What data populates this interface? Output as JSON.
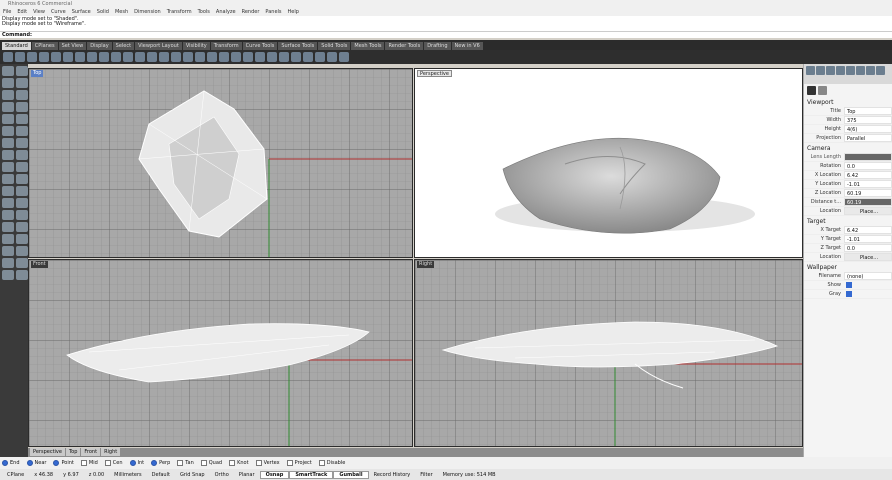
{
  "window": {
    "title": "Rhinoceros 6 Commercial"
  },
  "menu": [
    "File",
    "Edit",
    "View",
    "Curve",
    "Surface",
    "Solid",
    "Mesh",
    "Dimension",
    "Transform",
    "Tools",
    "Analyze",
    "Render",
    "Panels",
    "Help"
  ],
  "command_history": [
    "Display mode set to \"Shaded\".",
    "Display mode set to \"Wireframe\"."
  ],
  "command_prompt": "Command:",
  "toolbar_tabs": [
    "Standard",
    "CPlanes",
    "Set View",
    "Display",
    "Select",
    "Viewport Layout",
    "Visibility",
    "Transform",
    "Curve Tools",
    "Surface Tools",
    "Solid Tools",
    "Mesh Tools",
    "Render Tools",
    "Drafting",
    "New in V6"
  ],
  "active_toolbar_tab": "Standard",
  "viewports": {
    "top": {
      "title": "Top"
    },
    "perspective": {
      "title": "Perspective"
    },
    "front": {
      "title": "Front"
    },
    "right": {
      "title": "Right"
    }
  },
  "viewport_tabs": [
    "Perspective",
    "Top",
    "Front",
    "Right"
  ],
  "panel": {
    "viewport_header": "Viewport",
    "title_label": "Title",
    "title_value": "Top",
    "width_label": "Width",
    "width_value": "375",
    "height_label": "Height",
    "height_value": "4(6)",
    "projection_label": "Projection",
    "projection_value": "Parallel",
    "camera_header": "Camera",
    "lens_label": "Lens Length",
    "rotation_label": "Rotation",
    "rotation_value": "0.0",
    "xloc_label": "X Location",
    "xloc_value": "6.42",
    "yloc_label": "Y Location",
    "yloc_value": "-1.01",
    "zloc_label": "Z Location",
    "zloc_value": "60.19",
    "dist_label": "Distance t...",
    "dist_value": "60.19",
    "location_label": "Location",
    "location_btn": "Place...",
    "target_header": "Target",
    "xt_label": "X Target",
    "xt_value": "6.42",
    "yt_label": "Y Target",
    "yt_value": "-1.01",
    "zt_label": "Z Target",
    "zt_value": "0.0",
    "tloc_label": "Location",
    "tloc_btn": "Place...",
    "wallpaper_header": "Wallpaper",
    "filename_label": "Filename",
    "filename_value": "(none)",
    "show_label": "Show",
    "gray_label": "Gray"
  },
  "osnaps": [
    {
      "label": "End",
      "on": true
    },
    {
      "label": "Near",
      "on": true
    },
    {
      "label": "Point",
      "on": true
    },
    {
      "label": "Mid",
      "on": false
    },
    {
      "label": "Cen",
      "on": false
    },
    {
      "label": "Int",
      "on": true
    },
    {
      "label": "Perp",
      "on": true
    },
    {
      "label": "Tan",
      "on": false
    },
    {
      "label": "Quad",
      "on": false
    },
    {
      "label": "Knot",
      "on": false
    },
    {
      "label": "Vertex",
      "on": false
    },
    {
      "label": "Project",
      "on": false
    },
    {
      "label": "Disable",
      "on": false
    }
  ],
  "status": {
    "cplane": "CPlane",
    "x": "x 46.38",
    "y": "y 6.97",
    "z": "z 0.00",
    "units": "Millimeters",
    "layer": "Default",
    "grid_snap": "Grid Snap",
    "ortho": "Ortho",
    "planar": "Planar",
    "osnap": "Osnap",
    "smarttrack": "SmartTrack",
    "gumball": "Gumball",
    "record": "Record History",
    "filter": "Filter",
    "memory": "Memory use: 514 MB"
  },
  "colors": {
    "viewport_bg": "#a8a8a8",
    "perspective_bg": "#ffffff",
    "active_tab": "#5a7fc6",
    "x_axis": "#b03030"
  }
}
